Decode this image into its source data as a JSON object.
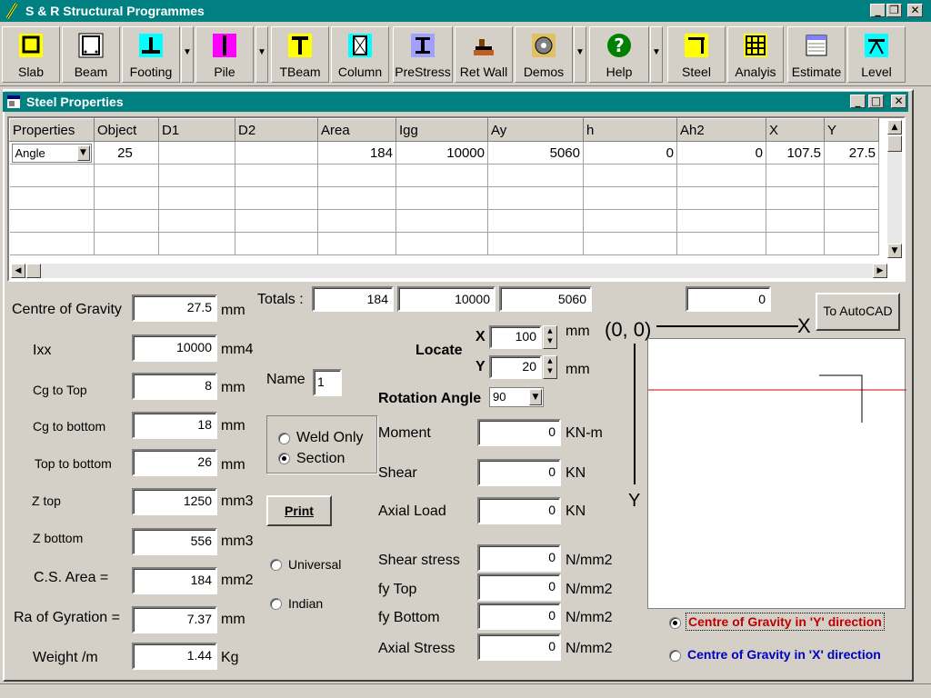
{
  "app": {
    "title": "S & R Structural Programmes"
  },
  "toolbar": [
    {
      "label": "Slab",
      "icon": "slab-icon",
      "dropdown": false
    },
    {
      "label": "Beam",
      "icon": "beam-icon",
      "dropdown": false
    },
    {
      "label": "Footing",
      "icon": "footing-icon",
      "dropdown": true
    },
    {
      "label": "Pile",
      "icon": "pile-icon",
      "dropdown": true
    },
    {
      "label": "TBeam",
      "icon": "tbeam-icon",
      "dropdown": false
    },
    {
      "label": "Column",
      "icon": "column-icon",
      "dropdown": false
    },
    {
      "label": "PreStress",
      "icon": "prestress-icon",
      "dropdown": false
    },
    {
      "label": "Ret Wall",
      "icon": "retwall-icon",
      "dropdown": false
    },
    {
      "label": "Demos",
      "icon": "demos-icon",
      "dropdown": true
    },
    {
      "label": "Help",
      "icon": "help-icon",
      "dropdown": true
    },
    {
      "label": "Steel",
      "icon": "steel-icon",
      "dropdown": false
    },
    {
      "label": "Analyis",
      "icon": "analysis-icon",
      "dropdown": false
    },
    {
      "label": "Estimate",
      "icon": "estimate-icon",
      "dropdown": false
    },
    {
      "label": "Level",
      "icon": "level-icon",
      "dropdown": false
    }
  ],
  "child": {
    "title": "Steel Properties"
  },
  "grid": {
    "headers": [
      "Properties",
      "Object",
      "D1",
      "D2",
      "Area",
      "Igg",
      "Ay",
      "h",
      "Ah2",
      "X",
      "Y"
    ],
    "row": {
      "properties": "Angle",
      "object": "25",
      "d1": "",
      "d2": "",
      "area": "184",
      "igg": "10000",
      "ay": "5060",
      "h": "0",
      "ah2": "0",
      "x": "107.5",
      "y": "27.5"
    }
  },
  "props": {
    "cg_label": "Centre of Gravity",
    "cg_value": "27.5",
    "cg_unit": "mm",
    "ixx_label": "Ixx",
    "ixx_value": "10000",
    "ixx_unit": "mm4",
    "cg_top_label": "Cg to Top",
    "cg_top_value": "8",
    "cg_top_unit": "mm",
    "cg_bottom_label": "Cg to bottom",
    "cg_bottom_value": "18",
    "cg_bottom_unit": "mm",
    "top_bottom_label": "Top to bottom",
    "top_bottom_value": "26",
    "top_bottom_unit": "mm",
    "ztop_label": "Z top",
    "ztop_value": "1250",
    "ztop_unit": "mm3",
    "zbottom_label": "Z bottom",
    "zbottom_value": "556",
    "zbottom_unit": "mm3",
    "csarea_label": "C.S. Area =",
    "csarea_value": "184",
    "csarea_unit": "mm2",
    "gyration_label": "Ra of Gyration =",
    "gyration_value": "7.37",
    "gyration_unit": "mm",
    "weight_label": "Weight /m",
    "weight_value": "1.44",
    "weight_unit": "Kg"
  },
  "totals": {
    "label": "Totals :",
    "area": "184",
    "igg": "10000",
    "ay": "5060",
    "ah2": "0"
  },
  "name": {
    "label": "Name",
    "value": "1"
  },
  "section_type": {
    "weld_only": "Weld Only",
    "section": "Section",
    "selected": "section"
  },
  "print_label": "Print",
  "standard": {
    "universal": "Universal",
    "indian": "Indian"
  },
  "locate": {
    "label": "Locate",
    "x_label": "X",
    "x_value": "100",
    "x_unit": "mm",
    "y_label": "Y",
    "y_value": "20",
    "y_unit": "mm"
  },
  "rotation": {
    "label": "Rotation Angle",
    "value": "90"
  },
  "loads": {
    "moment_label": "Moment",
    "moment_value": "0",
    "moment_unit": "KN-m",
    "shear_label": "Shear",
    "shear_value": "0",
    "shear_unit": "KN",
    "axial_label": "Axial Load",
    "axial_value": "0",
    "axial_unit": "KN",
    "shear_stress_label": "Shear stress",
    "shear_stress_value": "0",
    "shear_stress_unit": "N/mm2",
    "fy_top_label": "fy Top",
    "fy_top_value": "0",
    "fy_top_unit": "N/mm2",
    "fy_bottom_label": "fy Bottom",
    "fy_bottom_value": "0",
    "fy_bottom_unit": "N/mm2",
    "axial_stress_label": "Axial Stress",
    "axial_stress_value": "0",
    "axial_stress_unit": "N/mm2"
  },
  "autocad_label": "To AutoCAD",
  "diagram": {
    "origin": "(0, 0)",
    "x_axis": "X",
    "y_axis": "Y"
  },
  "cg_direction": {
    "y_label": "Centre of Gravity in 'Y' direction",
    "x_label": "Centre of Gravity in 'X' direction",
    "selected": "y"
  },
  "colors": {
    "title_bar": "#008080",
    "cg_y": "#c00000",
    "cg_x": "#0000c0"
  }
}
